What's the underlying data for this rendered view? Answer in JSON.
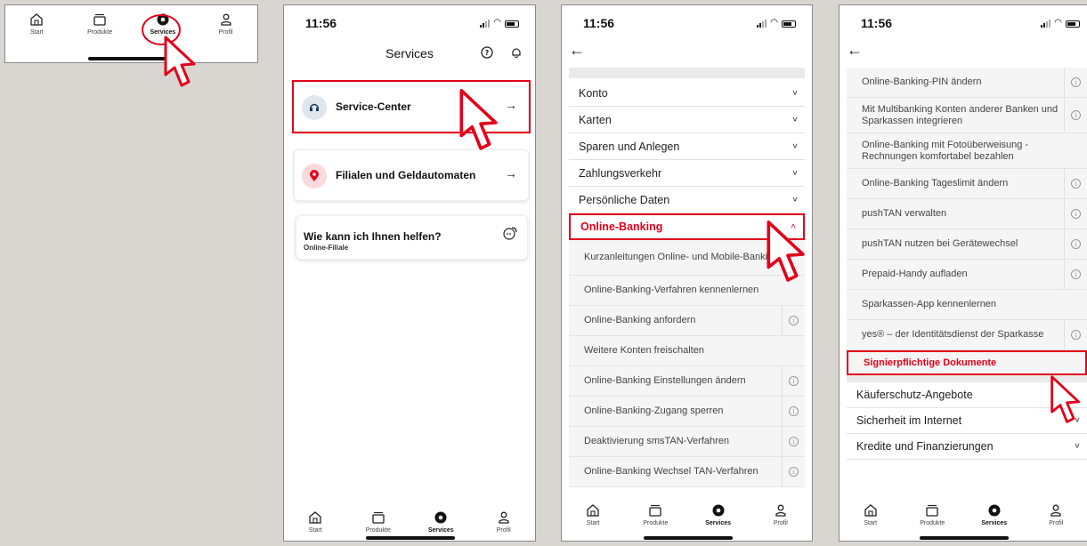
{
  "tabs": [
    {
      "label": "Start",
      "icon": "home-icon"
    },
    {
      "label": "Produkte",
      "icon": "wallet-icon"
    },
    {
      "label": "Services",
      "icon": "services-icon"
    },
    {
      "label": "Profil",
      "icon": "person-icon"
    }
  ],
  "status": {
    "time": "11:56"
  },
  "services": {
    "title": "Services",
    "service_center": "Service-Center",
    "filialen": "Filialen und Geldautomaten",
    "help_title": "Wie kann ich Ihnen helfen?",
    "help_sub": "Online-Filiale"
  },
  "menu": {
    "sections": [
      "Konto",
      "Karten",
      "Sparen und Anlegen",
      "Zahlungsverkehr",
      "Persönliche Daten",
      "Online-Banking"
    ],
    "online_banking_items": [
      "Kurzanleitungen Online- und Mobile-Banking",
      "Online-Banking-Verfahren kennenlernen",
      "Online-Banking anfordern",
      "Weitere Konten freischalten",
      "Online-Banking Einstellungen ändern",
      "Online-Banking-Zugang sperren",
      "Deaktivierung smsTAN-Verfahren",
      "Online-Banking Wechsel TAN-Verfahren"
    ]
  },
  "menu2": {
    "items": [
      "Online-Banking-PIN ändern",
      "Mit Multibanking Konten anderer Banken und Sparkassen integrieren",
      "Online-Banking mit Fotoüberweisung - Rechnungen komfortabel bezahlen",
      "Online-Banking Tageslimit ändern",
      "pushTAN verwalten",
      "pushTAN nutzen bei Gerätewechsel",
      "Prepaid-Handy aufladen",
      "Sparkassen-App kennenlernen",
      "yes® – der Identitätsdienst der Sparkasse",
      "Signierpflichtige Dokumente"
    ],
    "sections": [
      "Käuferschutz-Angebote",
      "Sicherheit im Internet",
      "Kredite und Finanzierungen"
    ]
  },
  "colors": {
    "accent": "#e2001a"
  }
}
